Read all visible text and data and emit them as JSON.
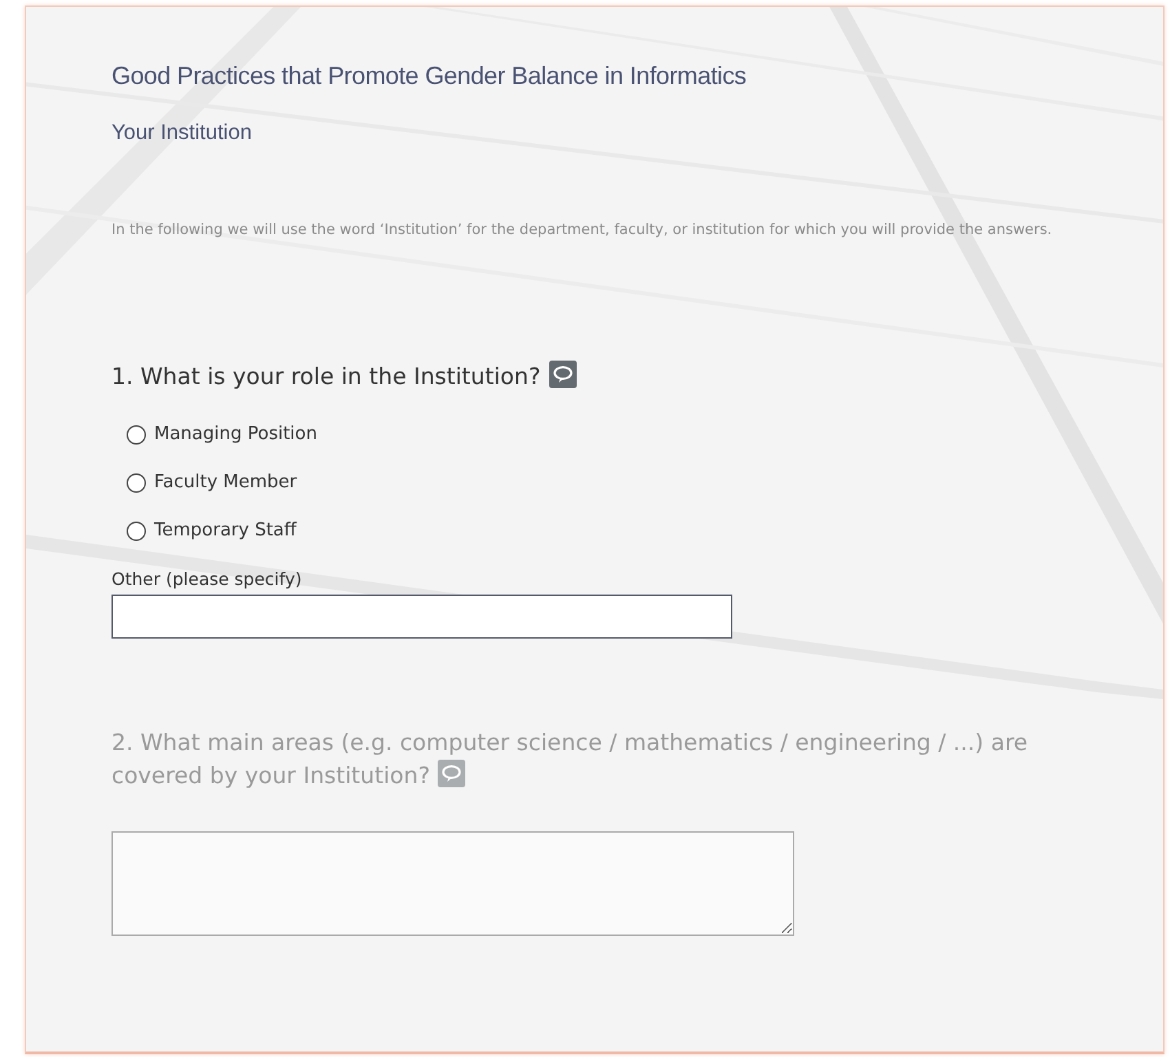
{
  "survey": {
    "title": "Good Practices that Promote Gender Balance in Informatics",
    "section": "Your Institution",
    "intro": "In the following we will use the word ‘Institution’ for the department, faculty, or institution for which you will provide the answers.",
    "questions": [
      {
        "kind": "radio",
        "text": "1. What is your role in the Institution?",
        "disabled": false,
        "options": [
          {
            "label": "Managing Position",
            "selected": false
          },
          {
            "label": "Faculty Member",
            "selected": false
          },
          {
            "label": "Temporary Staff",
            "selected": false
          }
        ],
        "other_label": "Other (please specify)"
      },
      {
        "kind": "textarea",
        "text": "2. What main areas (e.g. computer science / mathematics / engineering / ...) are covered by your Institution?",
        "disabled": true
      }
    ]
  }
}
